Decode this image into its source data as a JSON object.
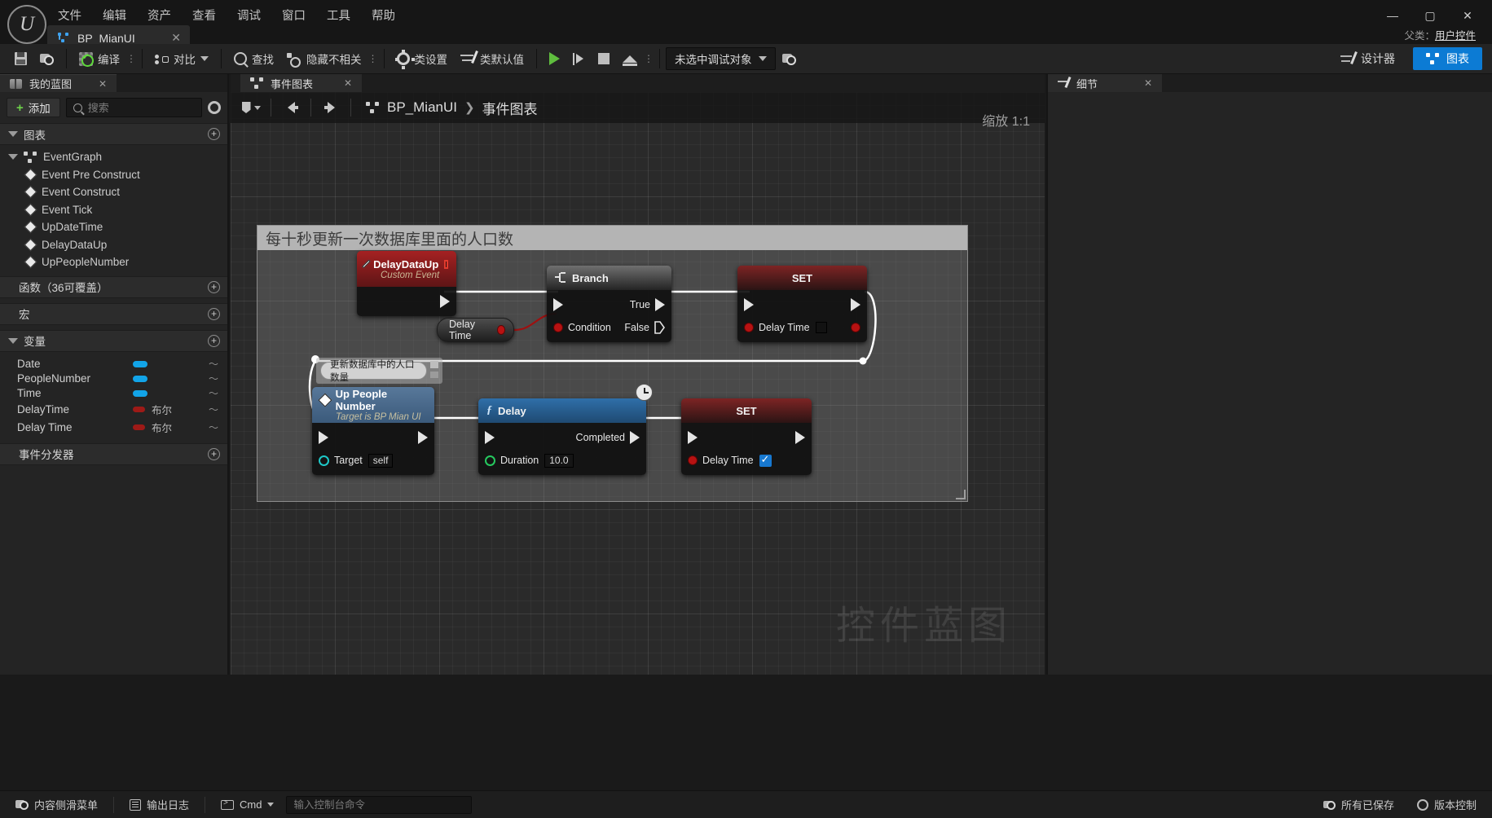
{
  "titlebar": {
    "logo": "ue-logo",
    "menu": [
      "文件",
      "编辑",
      "资产",
      "查看",
      "调试",
      "窗口",
      "工具",
      "帮助"
    ],
    "tab": {
      "label": "BP_MianUI",
      "close": "✕",
      "icon": "blueprint-icon"
    },
    "window_controls": {
      "minimize": "—",
      "maximize": "▢",
      "close": "✕"
    },
    "parent_class_label": "父类：",
    "parent_class_value": "用户控件"
  },
  "toolbar": {
    "save": "",
    "browse": "",
    "compile": "编译",
    "diff": "对比",
    "find": "查找",
    "hide_unrelated": "隐藏不相关",
    "class_settings": "类设置",
    "class_defaults": "类默认值",
    "debug_object": "未选中调试对象",
    "designer": "设计器",
    "graph": "图表",
    "accent": "#0c7bd4"
  },
  "left_panel": {
    "tab_title": "我的蓝图",
    "tab_close": "✕",
    "add_button": "添加",
    "search_placeholder": "搜索",
    "search_value": "",
    "sections": [
      {
        "label": "图表",
        "expanded": true
      },
      {
        "label": "函数（36可覆盖）",
        "expanded": false
      },
      {
        "label": "宏",
        "expanded": false
      },
      {
        "label": "变量",
        "expanded": true
      },
      {
        "label": "事件分发器",
        "expanded": false
      }
    ],
    "graph_root": "EventGraph",
    "graph_items": [
      "Event Pre Construct",
      "Event Construct",
      "Event Tick",
      "UpDateTime",
      "DelayDataUp",
      "UpPeopleNumber"
    ],
    "variables": [
      {
        "name": "Date",
        "type": "",
        "color": "#12a4e8"
      },
      {
        "name": "PeopleNumber",
        "type": "",
        "color": "#12a4e8"
      },
      {
        "name": "Time",
        "type": "",
        "color": "#12a4e8"
      },
      {
        "name": "DelayTime",
        "type": "布尔",
        "color": "#9e1a17"
      },
      {
        "name": "Delay Time",
        "type": "布尔",
        "color": "#9e1a17"
      }
    ]
  },
  "graph_panel": {
    "tab_title": "事件图表",
    "tab_close": "✕",
    "breadcrumb_root": "BP_MianUI",
    "breadcrumb_sep": "❯",
    "breadcrumb_leaf": "事件图表",
    "zoom_label": "缩放 1:1",
    "watermark": "控件蓝图",
    "comment": {
      "title": "每十秒更新一次数据库里面的人口数"
    },
    "nodes": [
      {
        "id": "delaydataup",
        "title": "DelayDataUp",
        "subtitle": "Custom Event",
        "kind": "custom-event"
      },
      {
        "id": "branch",
        "title": "Branch",
        "kind": "branch",
        "pins": {
          "condition": "Condition",
          "true": "True",
          "false": "False"
        }
      },
      {
        "id": "set-delaytime-1",
        "title": "SET",
        "kind": "set",
        "pin_label": "Delay Time",
        "value": ""
      },
      {
        "id": "delaytime-var",
        "title": "Delay Time",
        "kind": "variable-get"
      },
      {
        "id": "uppeoplenumber",
        "title": "Up People Number",
        "subtitle": "Target is BP Mian UI",
        "kind": "function-call",
        "pins": {
          "target": "Target",
          "target_value": "self"
        }
      },
      {
        "id": "delay",
        "title": "Delay",
        "kind": "latent-function",
        "pins": {
          "completed": "Completed",
          "duration": "Duration",
          "duration_value": "10.0"
        }
      },
      {
        "id": "set-delaytime-2",
        "title": "SET",
        "kind": "set",
        "pin_label": "Delay Time",
        "value": "checked"
      }
    ],
    "annotation_bubble": "更新数据库中的人口数量"
  },
  "right_panel": {
    "tab_title": "细节",
    "tab_close": "✕"
  },
  "statusbar": {
    "content_drawer": "内容侧滑菜单",
    "output_log": "输出日志",
    "cmd_label": "Cmd",
    "cmd_placeholder": "输入控制台命令",
    "cmd_value": "",
    "all_saved": "所有已保存",
    "revision_control": "版本控制"
  }
}
